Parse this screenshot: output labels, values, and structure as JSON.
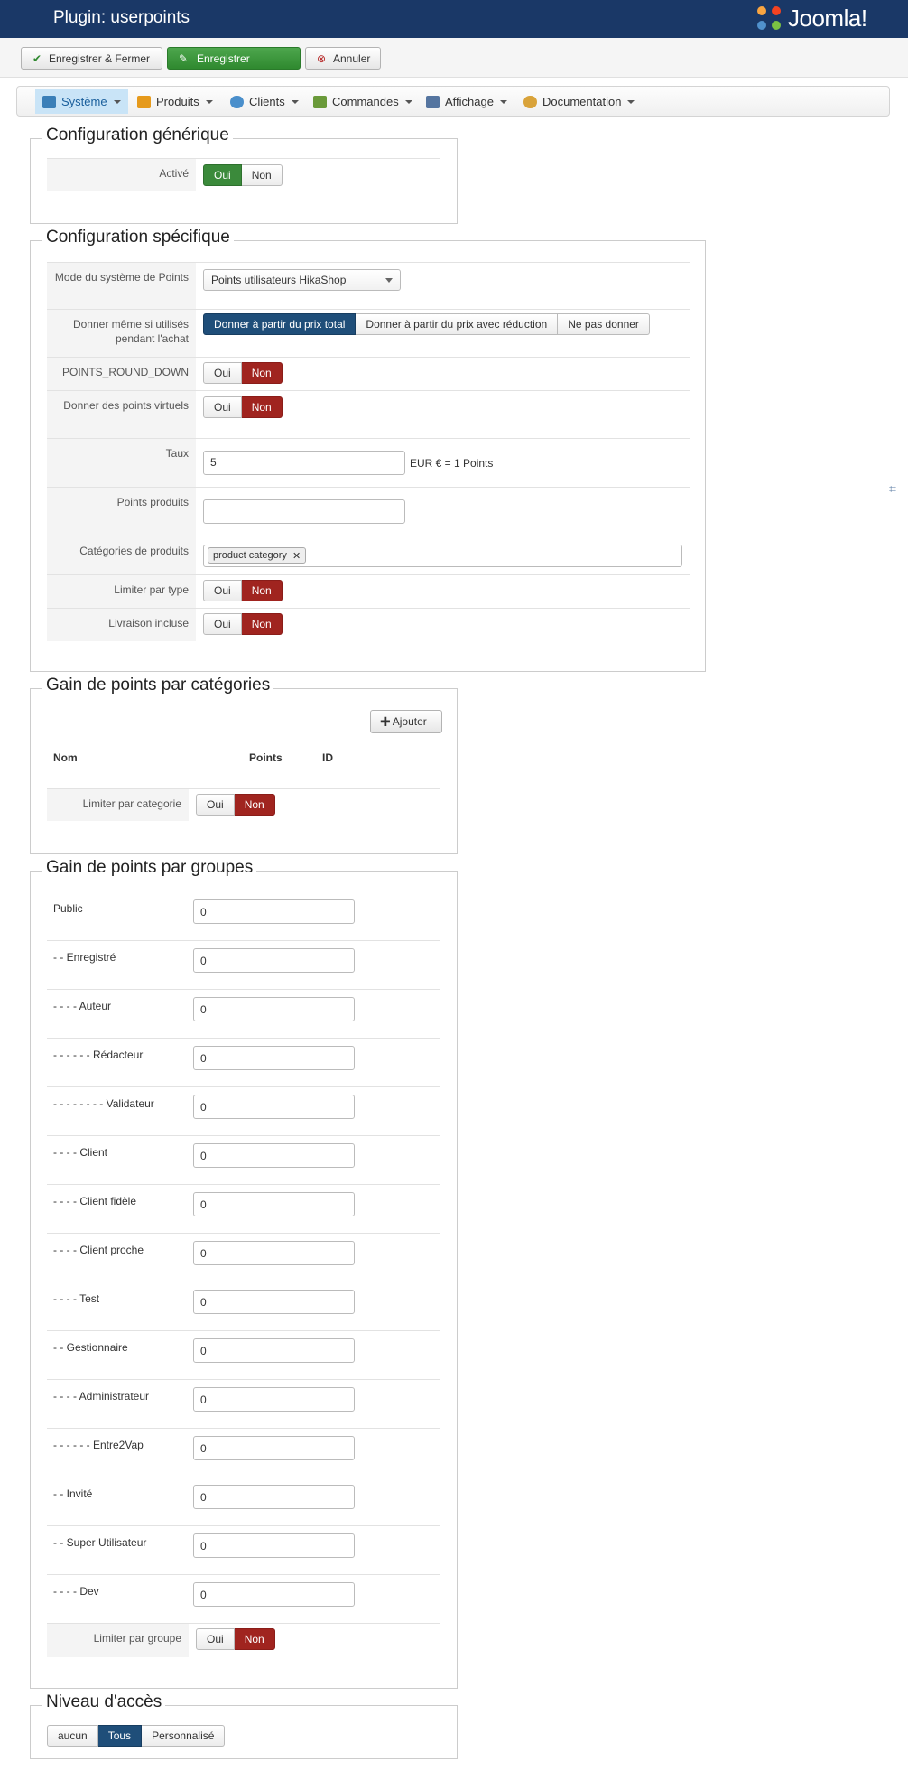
{
  "header": {
    "title": "Plugin: userpoints",
    "logo_text": "Joomla!"
  },
  "toolbar": {
    "save_close": "Enregistrer & Fermer",
    "save": "Enregistrer",
    "cancel": "Annuler"
  },
  "menu": {
    "items": [
      {
        "label": "Système",
        "icon": "wrench-icon",
        "color": "#3a7fb8"
      },
      {
        "label": "Produits",
        "icon": "box-icon",
        "color": "#e69a1c"
      },
      {
        "label": "Clients",
        "icon": "users-icon",
        "color": "#4a8fcb"
      },
      {
        "label": "Commandes",
        "icon": "chart-icon",
        "color": "#6a9a3a"
      },
      {
        "label": "Affichage",
        "icon": "display-icon",
        "color": "#5575a0"
      },
      {
        "label": "Documentation",
        "icon": "gears-icon",
        "color": "#d9a33a"
      }
    ]
  },
  "generic": {
    "legend": "Configuration générique",
    "active_label": "Activé",
    "yes": "Oui",
    "no": "Non"
  },
  "specific": {
    "legend": "Configuration spécifique",
    "mode_label": "Mode du système de Points",
    "mode_value": "Points utilisateurs HikaShop",
    "give_label": "Donner même si utilisés pendant l'achat",
    "give_options": [
      "Donner à partir du prix total",
      "Donner à partir du prix avec réduction",
      "Ne pas donner"
    ],
    "round_label": "POINTS_ROUND_DOWN",
    "virtual_label": "Donner des points virtuels",
    "rate_label": "Taux",
    "rate_value": "5",
    "rate_suffix": "EUR € = 1 Points",
    "produced_label": "Points produits",
    "produced_value": "",
    "categories_label": "Catégories de produits",
    "category_tag": "product category",
    "limit_type_label": "Limiter par type",
    "shipping_label": "Livraison incluse",
    "yes": "Oui",
    "no": "Non"
  },
  "categories": {
    "legend": "Gain de points par catégories",
    "add": "Ajouter",
    "col_name": "Nom",
    "col_points": "Points",
    "col_id": "ID",
    "limit_label": "Limiter par categorie",
    "yes": "Oui",
    "no": "Non"
  },
  "groups": {
    "legend": "Gain de points par groupes",
    "rows": [
      {
        "label": "Public",
        "value": "0"
      },
      {
        "label": "- - Enregistré",
        "value": "0"
      },
      {
        "label": "- - - - Auteur",
        "value": "0"
      },
      {
        "label": "- - - - - - Rédacteur",
        "value": "0"
      },
      {
        "label": "- - - - - - - - Validateur",
        "value": "0"
      },
      {
        "label": "- - - - Client",
        "value": "0"
      },
      {
        "label": "- - - - Client fidèle",
        "value": "0"
      },
      {
        "label": "- - - - Client proche",
        "value": "0"
      },
      {
        "label": "- - - - Test",
        "value": "0"
      },
      {
        "label": "- - Gestionnaire",
        "value": "0"
      },
      {
        "label": "- - - - Administrateur",
        "value": "0"
      },
      {
        "label": "- - - - - - Entre2Vap",
        "value": "0"
      },
      {
        "label": "- - Invité",
        "value": "0"
      },
      {
        "label": "- - Super Utilisateur",
        "value": "0"
      },
      {
        "label": "- - - - Dev",
        "value": "0"
      }
    ],
    "limit_label": "Limiter par groupe",
    "yes": "Oui",
    "no": "Non"
  },
  "access": {
    "legend": "Niveau d'accès",
    "options": [
      "aucun",
      "Tous",
      "Personnalisé"
    ]
  }
}
